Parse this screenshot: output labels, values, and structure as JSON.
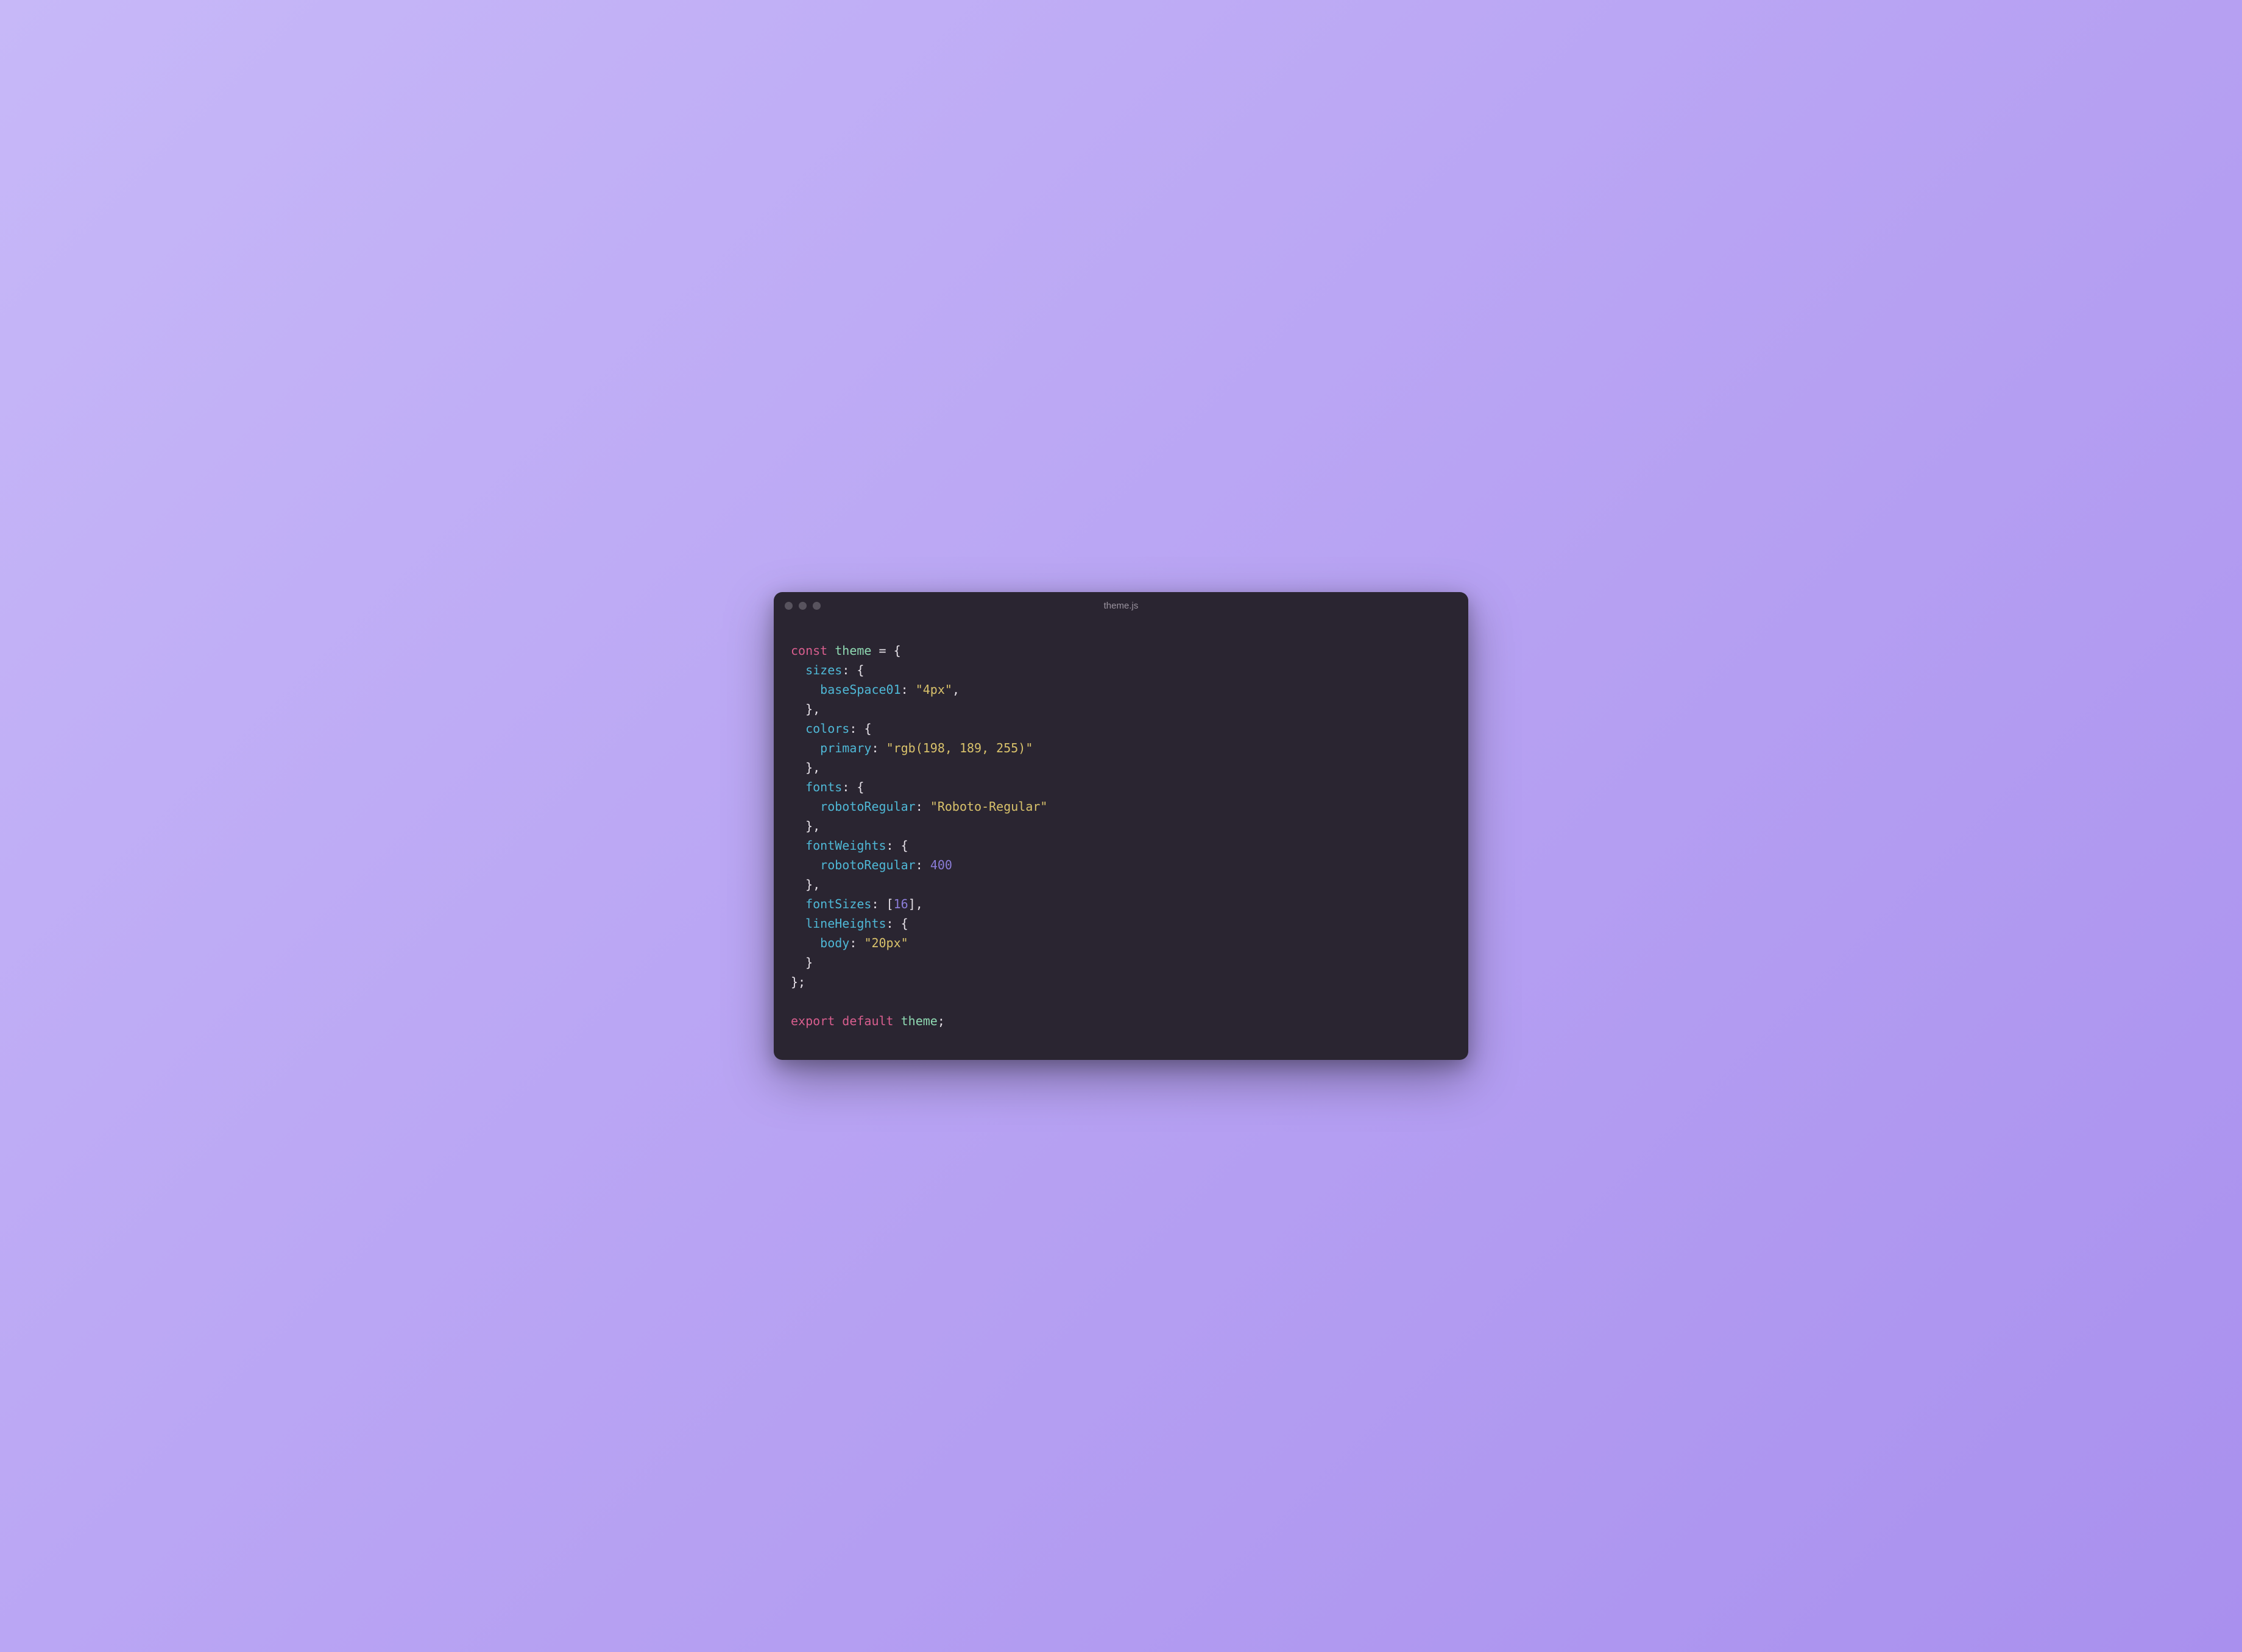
{
  "window": {
    "title": "theme.js"
  },
  "code": {
    "kw_const": "const",
    "var_theme": "theme",
    "op_eq": "=",
    "brace_open": "{",
    "brace_close": "}",
    "bracket_open": "[",
    "bracket_close": "]",
    "comma": ",",
    "colon": ":",
    "semicolon": ";",
    "key_sizes": "sizes",
    "key_baseSpace01": "baseSpace01",
    "str_4px": "\"4px\"",
    "key_colors": "colors",
    "key_primary": "primary",
    "str_rgb": "\"rgb(198, 189, 255)\"",
    "key_fonts": "fonts",
    "key_robotoRegular": "robotoRegular",
    "str_robotoRegular": "\"Roboto-Regular\"",
    "key_fontWeights": "fontWeights",
    "num_400": "400",
    "key_fontSizes": "fontSizes",
    "num_16": "16",
    "key_lineHeights": "lineHeights",
    "key_body": "body",
    "str_20px": "\"20px\"",
    "kw_export": "export",
    "kw_default": "default"
  }
}
